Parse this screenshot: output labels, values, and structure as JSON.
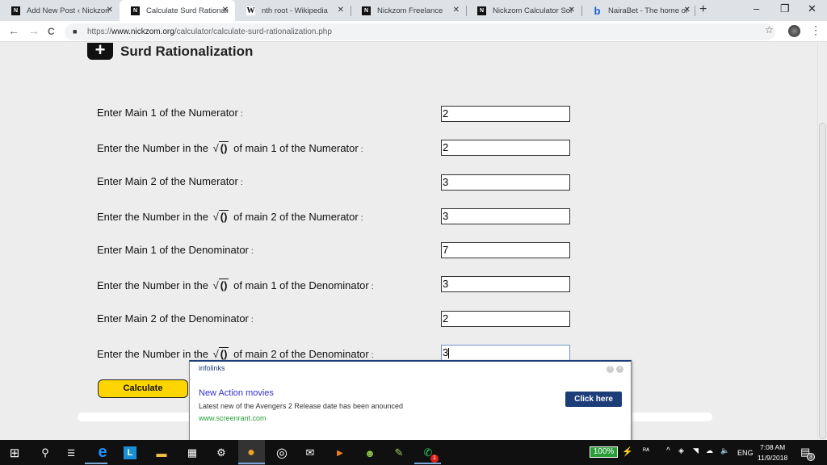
{
  "browser": {
    "tabs": [
      {
        "title": "Add New Post ‹ Nickzom",
        "icon": "nickzom-favicon",
        "active": false
      },
      {
        "title": "Calculate Surd Rationali",
        "icon": "nickzom-favicon",
        "active": true
      },
      {
        "title": "nth root - Wikipedia",
        "icon": "wikipedia-favicon",
        "active": false
      },
      {
        "title": "Nickzom Freelance",
        "icon": "nickzom-favicon",
        "active": false
      },
      {
        "title": "Nickzom Calculator Sol",
        "icon": "nickzom-favicon",
        "active": false
      },
      {
        "title": "NairaBet - The home of",
        "icon": "nairabet-favicon",
        "active": false
      }
    ],
    "favicon_glyphs": {
      "nickzom": "N",
      "wiki": "W",
      "naira": "b"
    },
    "new_tab": "+",
    "close_glyph": "✕",
    "window_controls": {
      "minimize": "–",
      "restore": "❐",
      "close": "✕"
    },
    "nav": {
      "back": "←",
      "forward": "→",
      "reload": "C"
    },
    "url": {
      "scheme": "https://",
      "domain": "www.nickzom.org",
      "path": "/calculator/calculate-surd-rationalization.php"
    },
    "lock": "🔒",
    "bookmark": "☆",
    "menu": "⋮"
  },
  "page": {
    "title_icon": "+",
    "title": "Surd Rationalization",
    "sqrt_symbol": "√",
    "sqrt_content": "()",
    "colon": ":",
    "rows": [
      {
        "label": "Enter Main 1 of the Numerator",
        "has_sqrt": false,
        "value": "2"
      },
      {
        "pre": "Enter the Number in the",
        "post": "of main 1 of the Numerator",
        "has_sqrt": true,
        "value": "2"
      },
      {
        "label": "Enter Main 2 of the Numerator",
        "has_sqrt": false,
        "value": "3"
      },
      {
        "pre": "Enter the Number in the",
        "post": "of main 2 of the Numerator",
        "has_sqrt": true,
        "value": "3"
      },
      {
        "label": "Enter Main 1 of the Denominator",
        "has_sqrt": false,
        "value": "7"
      },
      {
        "pre": "Enter the Number in the",
        "post": "of main 1 of the Denominator",
        "has_sqrt": true,
        "value": "3"
      },
      {
        "label": "Enter Main 2 of the Denominator",
        "has_sqrt": false,
        "value": "2"
      },
      {
        "pre": "Enter the Number in the",
        "post": "of main 2 of the Denominator",
        "has_sqrt": true,
        "value": "3"
      }
    ],
    "calculate_label": "Calculate"
  },
  "ad": {
    "brand": "infolinks",
    "help": "?",
    "close": "×",
    "headline": "New Action movies",
    "description": "Latest new of the Avengers 2 Release date has been anounced",
    "url": "www.screenrant.com",
    "cta": "Click here"
  },
  "taskbar": {
    "battery": "100%",
    "language": "ENG",
    "time": "7:08 AM",
    "date": "11/9/2018",
    "notification_count": "3",
    "whatsapp_badge": "1",
    "glyphs": {
      "start": "⊞",
      "search": "⚲",
      "taskview": "☰",
      "edge": "e",
      "lens": "L",
      "explorer": "▬",
      "calculator": "▦",
      "settings": "⚙",
      "chrome": "●",
      "groove": "◎",
      "mail": "✉",
      "media": "▶",
      "android": "☻",
      "notepad": "✎",
      "whatsapp": "✆",
      "power": "⚡",
      "people": "ᴿᴬ",
      "chevron": "^",
      "network": "◈",
      "wifi": "◥",
      "cloud": "☁",
      "volume": "🔈",
      "action-center": "▤"
    }
  }
}
